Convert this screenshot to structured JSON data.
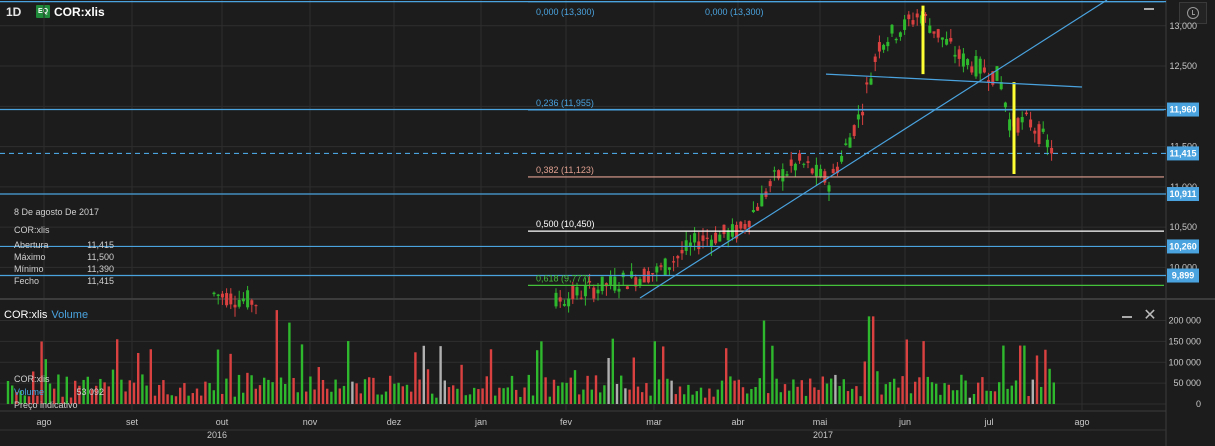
{
  "header": {
    "period": "1D",
    "badge": "EQ",
    "symbol": "COR:xlis"
  },
  "price_axis": {
    "ticks": [
      "13,000",
      "12,500",
      "12,000",
      "11,500",
      "11,000",
      "10,500",
      "10,000"
    ],
    "tick_values": [
      13000,
      12500,
      12000,
      11500,
      11000,
      10500,
      10000
    ],
    "range": [
      9620,
      13320
    ]
  },
  "horizontal_levels": [
    {
      "price": 13300,
      "color": "#4aa3df",
      "tag": ""
    },
    {
      "price": 11960,
      "color": "#4aa3df",
      "tag": "11,960"
    },
    {
      "price": 11415,
      "color": "#4aa3df",
      "tag": "11,415",
      "dashed": true
    },
    {
      "price": 10911,
      "color": "#4aa3df",
      "tag": "10,911"
    },
    {
      "price": 10260,
      "color": "#4aa3df",
      "tag": "10,260"
    },
    {
      "price": 9899,
      "color": "#4aa3df",
      "tag": "9,899"
    }
  ],
  "fibonacci": [
    {
      "label": "0,000 (13,300)",
      "price": 13300,
      "color": "#4aa3df"
    },
    {
      "label": "0,000 (13,300)",
      "price": 13300,
      "color": "#4aa3df",
      "secondary": true
    },
    {
      "label": "0,236 (11,955)",
      "price": 11955,
      "color": "#4aa3df"
    },
    {
      "label": "0,382 (11,123)",
      "price": 11123,
      "color": "#e0a090"
    },
    {
      "label": "0,500 (10,450)",
      "price": 10450,
      "color": "#ffffff"
    },
    {
      "label": "0,618 (9,777)",
      "price": 9777,
      "color": "#44c23a"
    }
  ],
  "info_panel": {
    "date": "8 De agosto De 2017",
    "symbol": "COR:xlis",
    "rows": [
      {
        "label": "Abertura",
        "value": "11,415"
      },
      {
        "label": "Máximo",
        "value": "11,500"
      },
      {
        "label": "Mínimo",
        "value": "11,390"
      },
      {
        "label": "Fecho",
        "value": "11,415"
      }
    ]
  },
  "volume_panel": {
    "symbol": "COR:xlis",
    "title": "Volume",
    "axis_ticks": [
      "200 000",
      "150 000",
      "100 000",
      "50 000",
      "0"
    ],
    "axis_values": [
      200000,
      150000,
      100000,
      50000,
      0
    ],
    "info": {
      "symbol": "COR:xlis",
      "label": "Volume",
      "value": "53 092",
      "note": "Preço indicativo"
    }
  },
  "time_axis": {
    "months": [
      "ago",
      "set",
      "out",
      "nov",
      "dez",
      "jan",
      "fev",
      "mar",
      "abr",
      "mai",
      "jun",
      "jul",
      "ago"
    ],
    "years": [
      "2016",
      "2017"
    ]
  },
  "colors": {
    "background": "#1c1c1c",
    "up": "#2eb82e",
    "down": "#d94040",
    "neutral": "#b0b0b0",
    "accent": "#4aa3df",
    "highlight": "#ffff33"
  },
  "chart_data": [
    {
      "type": "candlestick",
      "title": "COR:xlis",
      "interval": "1D",
      "ylim": [
        9620,
        13320
      ],
      "last": {
        "date": "8 De agosto De 2017",
        "open": 11415,
        "high": 11500,
        "low": 11390,
        "close": 11415
      },
      "approx_path": [
        {
          "month": "out 2016",
          "price": 9700
        },
        {
          "month": "fev 2017",
          "price": 9650
        },
        {
          "month": "mar 2017",
          "price": 9900
        },
        {
          "month": "abr 2017",
          "price": 10700
        },
        {
          "month": "mai 2017",
          "price": 11500
        },
        {
          "month": "jun 2017",
          "price": 13100
        },
        {
          "month": "jul 2017",
          "price": 12400
        },
        {
          "month": "ago 2017",
          "price": 11415
        }
      ]
    },
    {
      "type": "bar",
      "title": "Volume",
      "ylim": [
        0,
        230000
      ],
      "last": 53092,
      "peaks": [
        {
          "month": "out 2016",
          "value": 225000
        },
        {
          "month": "out 2016",
          "value": 195000
        },
        {
          "month": "jun 2017",
          "value": 210000
        },
        {
          "month": "jul 2017",
          "value": 145000
        }
      ]
    }
  ]
}
